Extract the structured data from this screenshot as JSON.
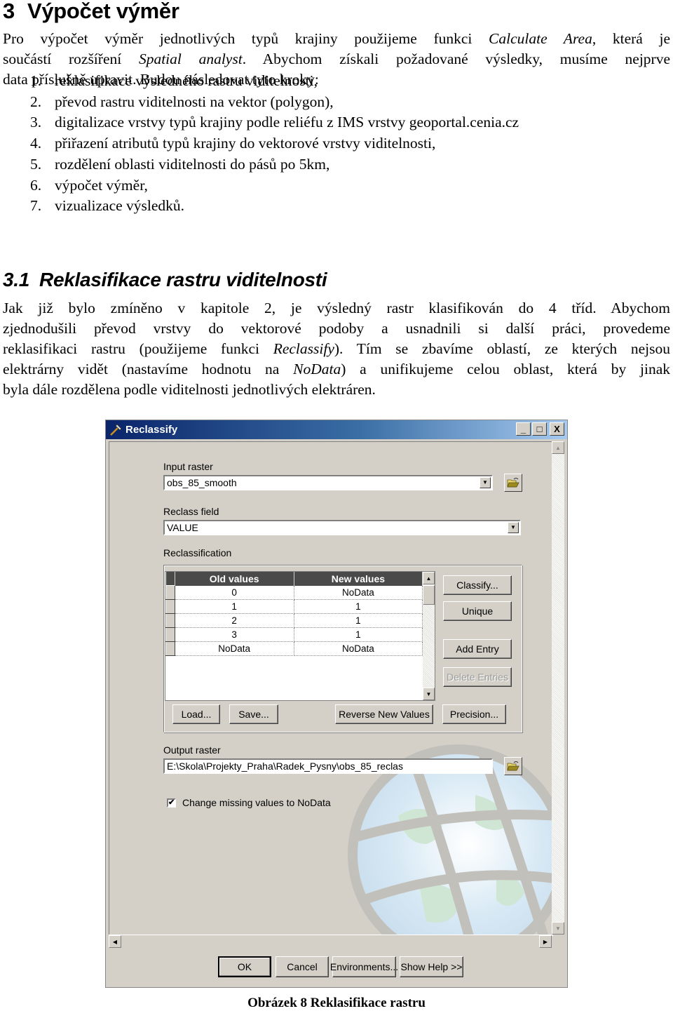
{
  "heading1": {
    "number": "3",
    "title": "Výpočet výměr"
  },
  "intro": {
    "lines": [
      [
        "Pro výpočet výměr jednotlivých typů krajiny použijeme funkci ",
        "Calculate Area",
        ", která je"
      ],
      [
        "součástí rozšíření ",
        "Spatial analyst",
        ". Abychom získali požadované výsledky, musíme nejprve"
      ],
      [
        "data příslušně upravit. Budou následovat tyto kroky:",
        "",
        ""
      ]
    ]
  },
  "steps": [
    {
      "n": "1.",
      "text": "reklasifikace výsledného rastru viditelnosti,"
    },
    {
      "n": "2.",
      "text": "převod rastru viditelnosti na vektor (polygon),"
    },
    {
      "n": "3.",
      "text": "digitalizace vrstvy typů krajiny podle reliéfu z IMS vrstvy geoportal.cenia.cz"
    },
    {
      "n": "4.",
      "text": "přiřazení atributů typů krajiny do vektorové vrstvy viditelnosti,"
    },
    {
      "n": "5.",
      "text": "rozdělení oblasti viditelnosti do pásů po 5km,"
    },
    {
      "n": "6.",
      "text": "výpočet výměr,"
    },
    {
      "n": "7.",
      "text": "vizualizace výsledků."
    }
  ],
  "heading2": {
    "number": "3.1",
    "title": "Reklasifikace rastru viditelnosti"
  },
  "section": {
    "lines": [
      [
        "Jak již bylo zmíněno v kapitole 2, je výsledný rastr klasifikován do 4 tříd. Abychom",
        "",
        ""
      ],
      [
        "zjednodušili převod vrstvy do vektorové podoby a usnadnili si další práci, provedeme",
        "",
        ""
      ],
      [
        "reklasifikaci rastru (použijeme funkci ",
        "Reclassify",
        "). Tím se zbavíme oblastí, ze kterých nejsou"
      ],
      [
        "elektrárny vidět (nastavíme hodnotu na ",
        "NoData",
        ") a unifikujeme celou oblast, která by jinak"
      ],
      [
        "byla dále rozdělena podle viditelnosti jednotlivých elektráren.",
        "",
        ""
      ]
    ]
  },
  "dialog": {
    "title": "Reclassify",
    "title_buttons": {
      "minimize": "_",
      "maximize": "□",
      "close": "X"
    },
    "input_raster": {
      "label": "Input raster",
      "value": "obs_85_smooth"
    },
    "reclass_field": {
      "label": "Reclass field",
      "value": "VALUE"
    },
    "reclassification": {
      "label": "Reclassification",
      "columns": [
        "Old values",
        "New values"
      ],
      "rows": [
        [
          "0",
          "NoData"
        ],
        [
          "1",
          "1"
        ],
        [
          "2",
          "1"
        ],
        [
          "3",
          "1"
        ],
        [
          "NoData",
          "NoData"
        ]
      ],
      "side_buttons": [
        "Classify...",
        "Unique",
        "Add Entry",
        "Delete Entries"
      ],
      "bottom_buttons": [
        "Load...",
        "Save...",
        "Reverse New Values",
        "Precision..."
      ]
    },
    "output_raster": {
      "label": "Output raster",
      "value": "E:\\Skola\\Projekty_Praha\\Radek_Pysny\\obs_85_reclas"
    },
    "checkbox": {
      "label": "Change missing values to NoData",
      "checked": true,
      "mark": "✔"
    },
    "footer_buttons": [
      "OK",
      "Cancel",
      "Environments...",
      "Show Help >>"
    ],
    "colors": {
      "titlebar_start": "#0a246a",
      "titlebar_end": "#a6caf0",
      "face": "#d4d0c8",
      "grid_header": "#4a4a4a"
    }
  },
  "caption": "Obrázek 8 Reklasifikace rastru"
}
